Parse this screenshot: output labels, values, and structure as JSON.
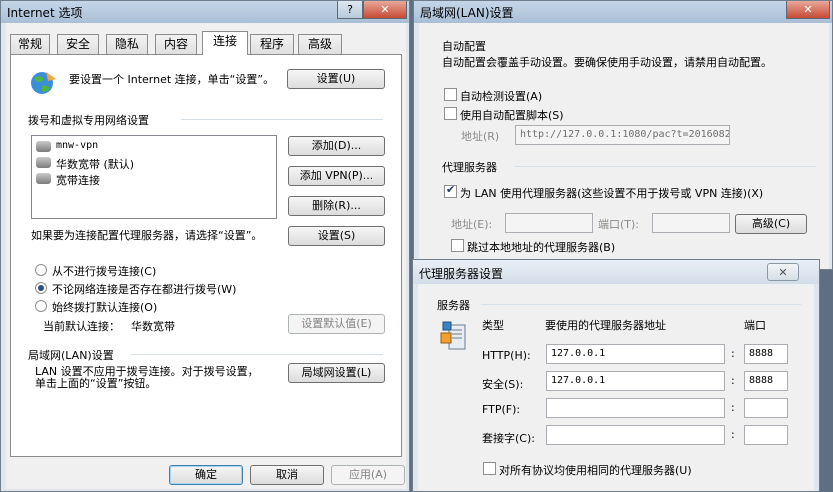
{
  "internet_options": {
    "title": "Internet 选项",
    "help_glyph": "?",
    "close_glyph": "✕",
    "tabs": [
      "常规",
      "安全",
      "隐私",
      "内容",
      "连接",
      "程序",
      "高级"
    ],
    "setup_text": "要设置一个 Internet 连接，单击“设置”。",
    "setup_button": "设置(U)",
    "dialup_section": "拨号和虚拟专用网络设置",
    "connections": [
      "mnw-vpn",
      "华数宽带 (默认)",
      "宽带连接"
    ],
    "add_button": "添加(D)...",
    "add_vpn_button": "添加 VPN(P)...",
    "remove_button": "删除(R)...",
    "proxy_text": "如果要为连接配置代理服务器，请选择“设置”。",
    "settings_button": "设置(S)",
    "radio_never": "从不进行拨号连接(C)",
    "radio_no_network": "不论网络连接是否存在都进行拨号(W)",
    "radio_always": "始终拨打默认连接(O)",
    "current_default_label": "当前默认连接：",
    "current_default_value": "华数宽带",
    "set_default_button": "设置默认值(E)",
    "lan_section": "局域网(LAN)设置",
    "lan_text": "LAN 设置不应用于拨号连接。对于拨号设置，单击上面的“设置”按钮。",
    "lan_button": "局域网设置(L)",
    "ok_button": "确定",
    "cancel_button": "取消",
    "apply_button": "应用(A)"
  },
  "lan_settings": {
    "title": "局域网(LAN)设置",
    "close_glyph": "✕",
    "auto_config_title": "自动配置",
    "auto_config_desc": "自动配置会覆盖手动设置。要确保使用手动设置，请禁用自动配置。",
    "auto_detect": "自动检测设置(A)",
    "use_script": "使用自动配置脚本(S)",
    "address_label": "地址(R)",
    "address_value": "http://127.0.0.1:1080/pac?t=2016082",
    "proxy_title": "代理服务器",
    "use_proxy": "为 LAN 使用代理服务器(这些设置不用于拨号或 VPN 连接)(X)",
    "address2_label": "地址(E):",
    "port_label": "端口(T):",
    "advanced_button": "高级(C)",
    "bypass_local": "跳过本地地址的代理服务器(B)"
  },
  "proxy_settings": {
    "title": "代理服务器设置",
    "close_glyph": "✕",
    "servers_title": "服务器",
    "col_type": "类型",
    "col_address": "要使用的代理服务器地址",
    "col_port": "端口",
    "rows": [
      {
        "type": "HTTP(H):",
        "address": "127.0.0.1",
        "port": "8888"
      },
      {
        "type": "安全(S):",
        "address": "127.0.0.1",
        "port": "8888"
      },
      {
        "type": "FTP(F):",
        "address": "",
        "port": ""
      },
      {
        "type": "套接字(C):",
        "address": "",
        "port": ""
      }
    ],
    "colon": ":",
    "same_proxy": "对所有协议均使用相同的代理服务器(U)"
  }
}
